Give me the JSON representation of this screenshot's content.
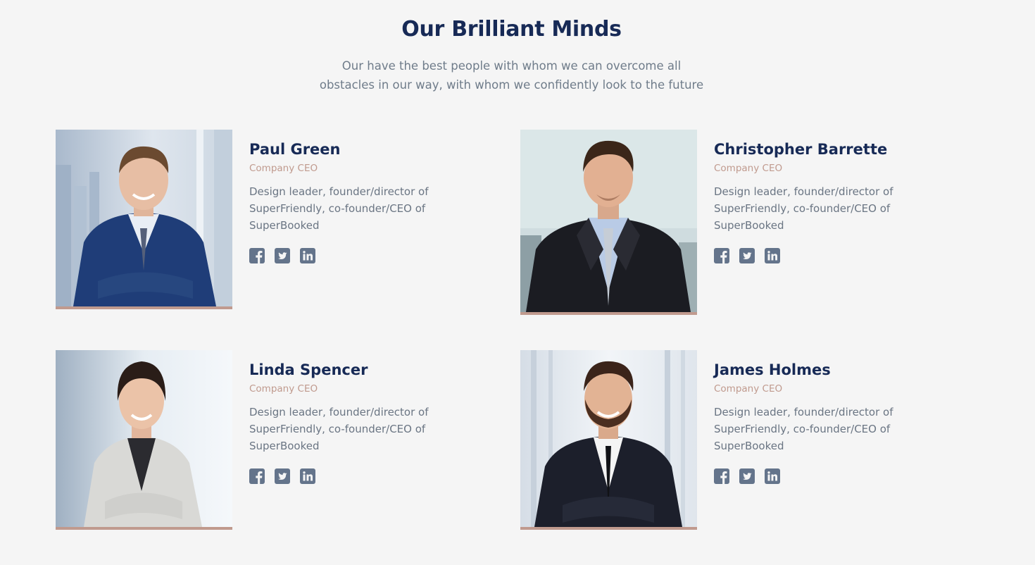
{
  "section": {
    "title": "Our Brilliant Minds",
    "subtitle_line1": "Our have the best people with whom we can overcome all",
    "subtitle_line2": "obstacles in our way, with whom we confidently look to the future"
  },
  "colors": {
    "heading": "#172a56",
    "role": "#c09a8e",
    "body_text": "#6a7583",
    "icon": "#64748b",
    "accent_bar": "#c09a8e",
    "background": "#f5f5f5"
  },
  "members": [
    {
      "name": "Paul Green",
      "role": "Company CEO",
      "desc_line1": "Design leader, founder/director of",
      "desc_line2": "SuperFriendly, co-founder/CEO of",
      "desc_line3": "SuperBooked",
      "socials": [
        "facebook-icon",
        "twitter-icon",
        "linkedin-icon"
      ]
    },
    {
      "name": "Christopher Barrette",
      "role": "Company CEO",
      "desc_line1": "Design leader, founder/director of",
      "desc_line2": "SuperFriendly, co-founder/CEO of",
      "desc_line3": "SuperBooked",
      "socials": [
        "facebook-icon",
        "twitter-icon",
        "linkedin-icon"
      ]
    },
    {
      "name": "Linda Spencer",
      "role": "Company CEO",
      "desc_line1": "Design leader, founder/director of",
      "desc_line2": "SuperFriendly, co-founder/CEO of",
      "desc_line3": "SuperBooked",
      "socials": [
        "facebook-icon",
        "twitter-icon",
        "linkedin-icon"
      ]
    },
    {
      "name": "James Holmes",
      "role": "Company CEO",
      "desc_line1": "Design leader, founder/director of",
      "desc_line2": "SuperFriendly, co-founder/CEO of",
      "desc_line3": "SuperBooked",
      "socials": [
        "facebook-icon",
        "twitter-icon",
        "linkedin-icon"
      ]
    }
  ]
}
